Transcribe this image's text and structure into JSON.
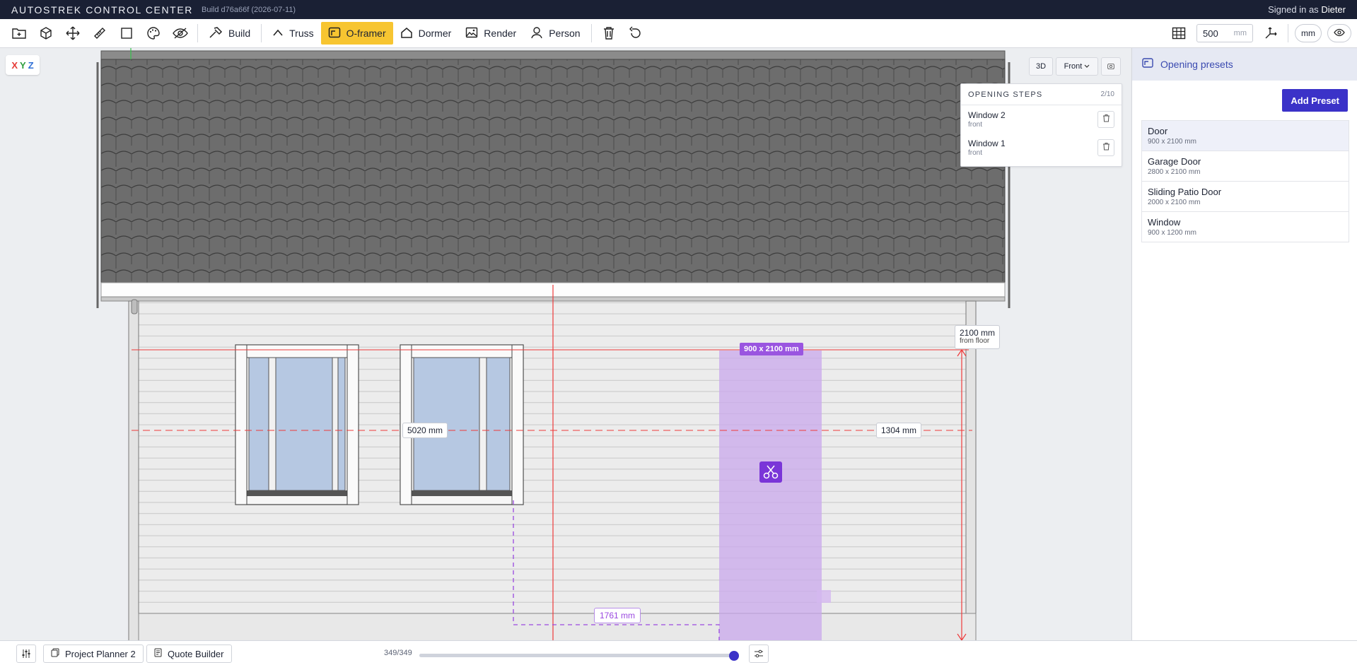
{
  "topbar": {
    "title": "AUTOSTREK CONTROL CENTER",
    "build": "Build d76a66f (2026-07-11)",
    "signed_in_prefix": "Signed in as",
    "user": "Dieter"
  },
  "toolbar": {
    "tools": [
      {
        "name": "Build",
        "icon": "hammer-icon",
        "active": false
      },
      {
        "name": "Truss",
        "icon": "caret-up-icon",
        "active": false
      },
      {
        "name": "O-framer",
        "icon": "frame-icon",
        "active": true
      },
      {
        "name": "Dormer",
        "icon": "house-icon",
        "active": false
      },
      {
        "name": "Render",
        "icon": "image-icon",
        "active": false
      },
      {
        "name": "Person",
        "icon": "person-icon",
        "active": false
      }
    ],
    "grid_value": "500",
    "grid_unit": "mm",
    "unit_toggle": "mm"
  },
  "canvas": {
    "axes": [
      "X",
      "Y",
      "Z"
    ],
    "axis_colors": [
      "#e53935",
      "#2e9e3e",
      "#2f6fd6"
    ],
    "view_mode": "3D",
    "view_dir": "Front",
    "dims": {
      "height_from_floor": "2100 mm",
      "height_from_floor_sub": "from floor",
      "left_offset": "5020 mm",
      "right_offset": "1304 mm",
      "bottom_offset": "1761 mm",
      "preset_size": "900 x 2100 mm"
    }
  },
  "opening_steps": {
    "title": "OPENING STEPS",
    "count": "2/10",
    "items": [
      {
        "name": "Window 2",
        "side": "front"
      },
      {
        "name": "Window 1",
        "side": "front"
      }
    ]
  },
  "presets_panel": {
    "title": "Opening presets",
    "add_label": "Add Preset",
    "items": [
      {
        "name": "Door",
        "size": "900 x 2100 mm",
        "selected": true
      },
      {
        "name": "Garage Door",
        "size": "2800 x 2100 mm",
        "selected": false
      },
      {
        "name": "Sliding Patio Door",
        "size": "2000 x 2100 mm",
        "selected": false
      },
      {
        "name": "Window",
        "size": "900 x 1200 mm",
        "selected": false
      }
    ]
  },
  "bottombar": {
    "tabs": [
      "Project Planner 2",
      "Quote Builder"
    ],
    "counter": "349/349",
    "progress": 1.0
  }
}
